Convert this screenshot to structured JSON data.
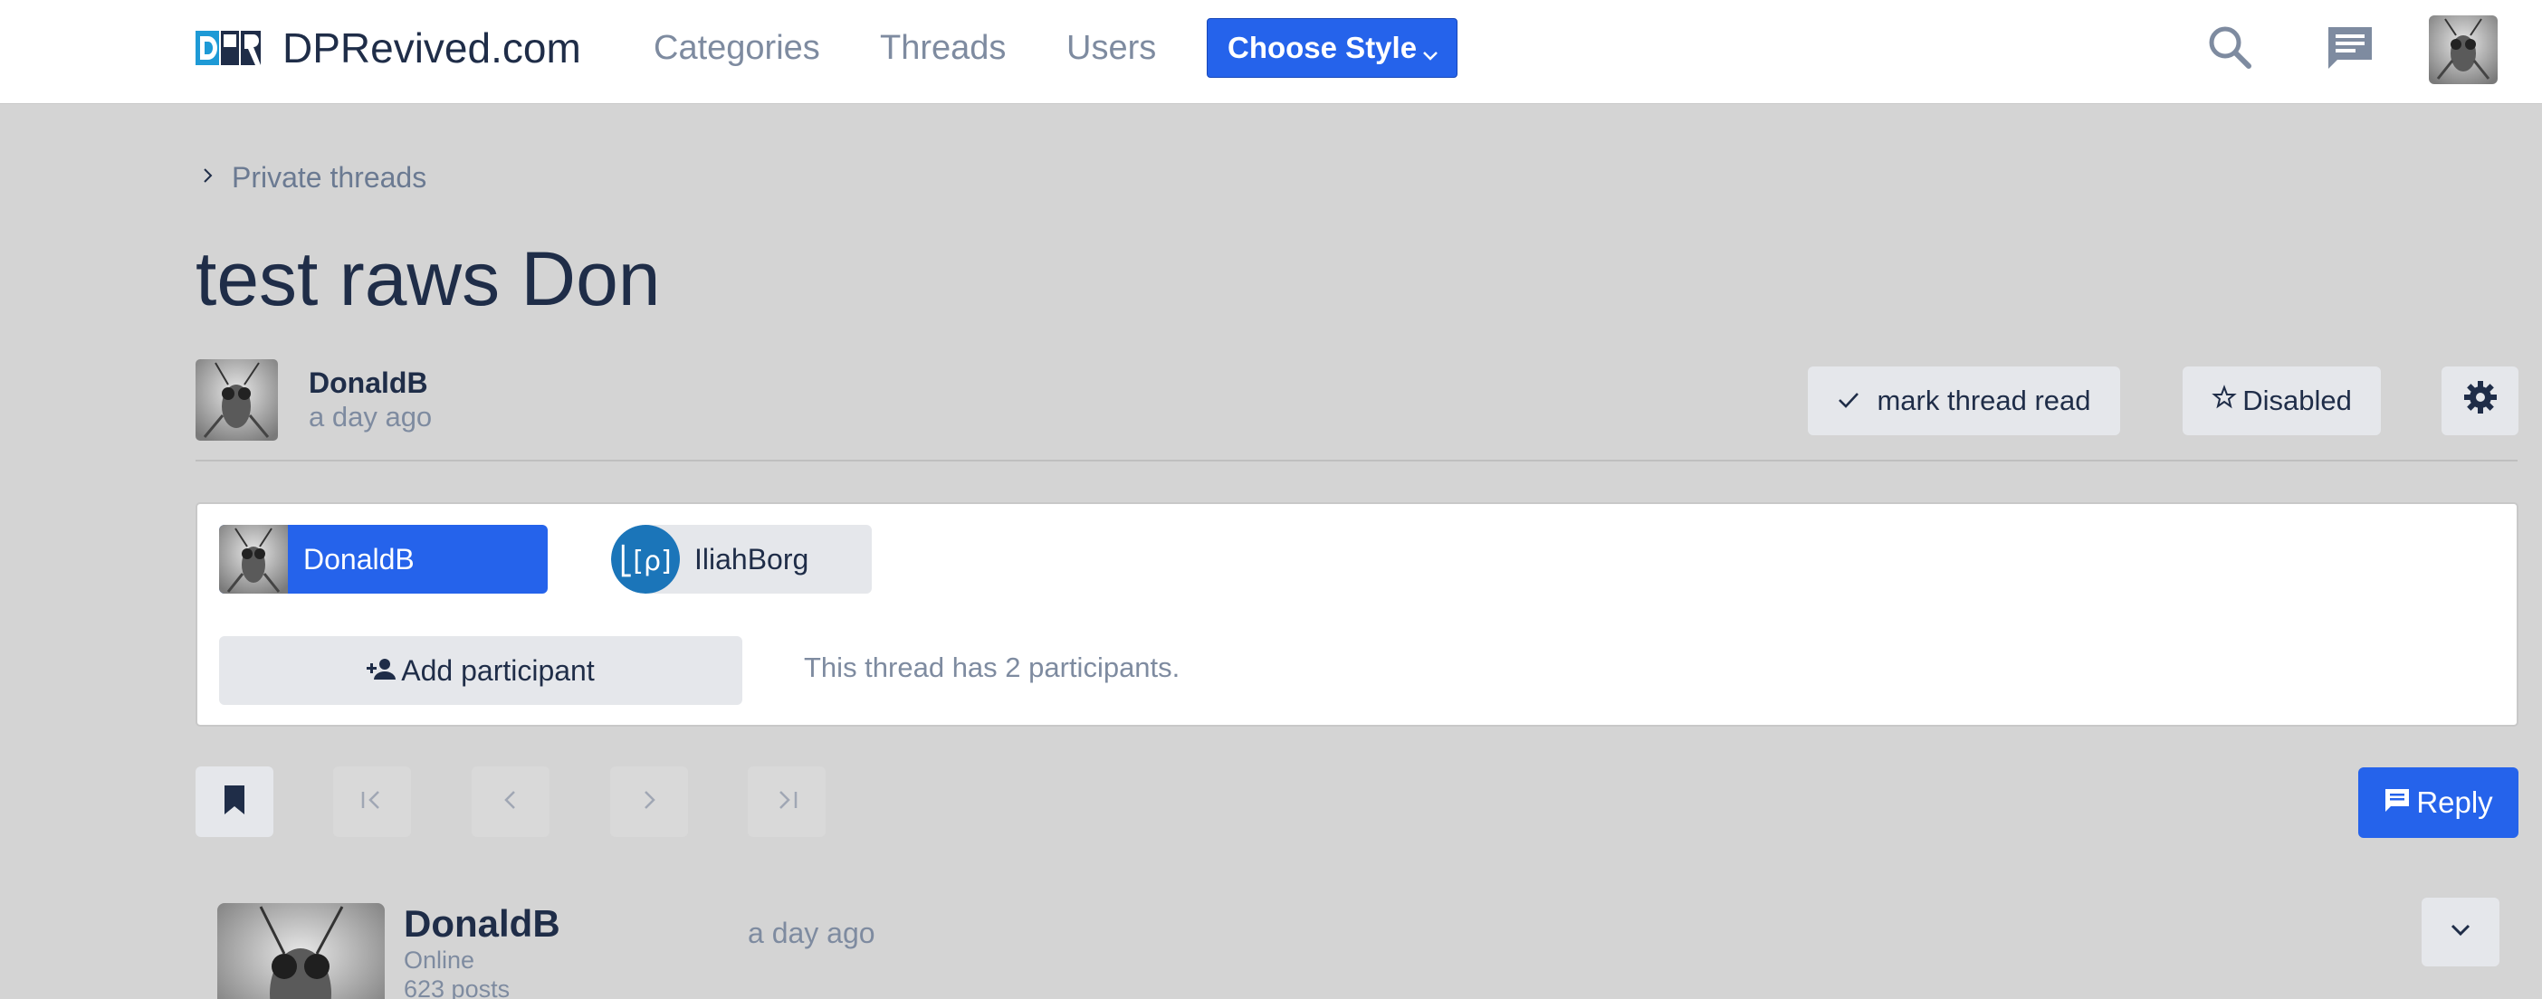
{
  "navbar": {
    "site_name": "DPRevived.com",
    "links": [
      "Categories",
      "Threads",
      "Users"
    ],
    "style_button": "Choose Style",
    "icons": [
      "search-icon",
      "chat-icon",
      "user-avatar"
    ]
  },
  "breadcrumb": {
    "label": "Private threads"
  },
  "thread": {
    "title": "test raws Don",
    "author": "DonaldB",
    "started": "a day ago",
    "mark_read_label": "mark thread read",
    "watch_label": "Disabled"
  },
  "participants": {
    "list": [
      "DonaldB",
      "IliahBorg"
    ],
    "add_label": "Add participant",
    "count_text": "This thread has 2 participants."
  },
  "toolbar": {
    "reply_label": "Reply"
  },
  "post": {
    "author": "DonaldB",
    "status": "Online",
    "posts": "623 posts",
    "time": "a day ago"
  },
  "colors": {
    "primary": "#2563eb",
    "background": "#d4d4d4",
    "text": "#1f2d48",
    "muted": "#7e8ba0"
  }
}
